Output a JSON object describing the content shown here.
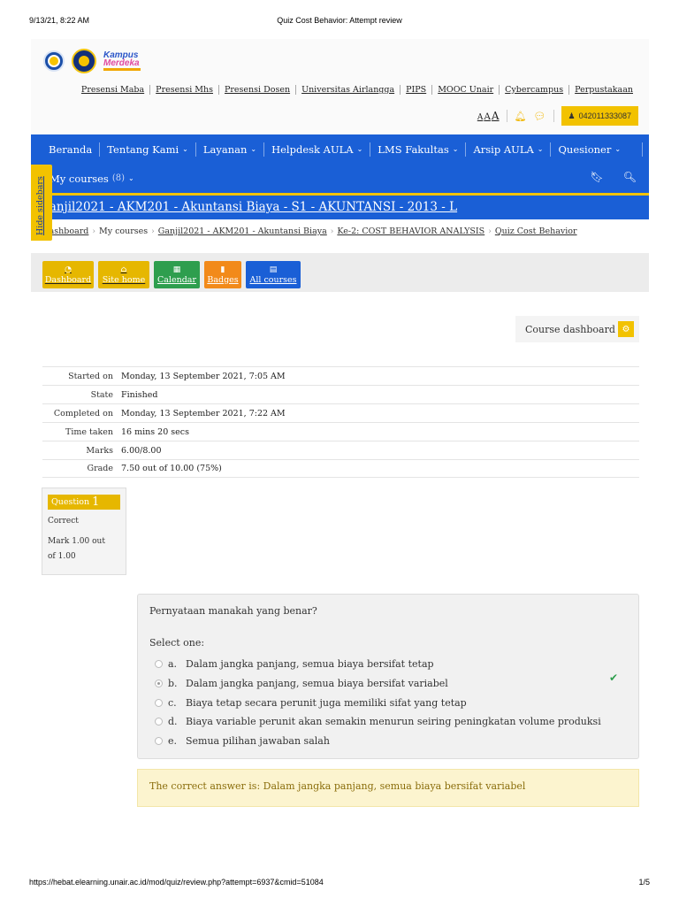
{
  "print": {
    "timestamp": "9/13/21, 8:22 AM",
    "title": "Quiz Cost Behavior: Attempt review",
    "url": "https://hebat.elearning.unair.ac.id/mod/quiz/review.php?attempt=6937&cmid=51084",
    "page": "1/5"
  },
  "logo": {
    "kampus_line1": "Kampus",
    "kampus_line2": "Merdeka"
  },
  "quicklinks": [
    "Presensi Maba",
    "Presensi Mhs",
    "Presensi Dosen",
    "Universitas Airlangga",
    "PIPS",
    "MOOC Unair",
    "Cybercampus",
    "Perpustakaan"
  ],
  "util": {
    "font_sizes": [
      "A",
      "A",
      "A"
    ],
    "phone": "0420113330​87"
  },
  "nav": {
    "items": [
      {
        "label": "Beranda",
        "dropdown": false
      },
      {
        "label": "Tentang Kami",
        "dropdown": true
      },
      {
        "label": "Layanan",
        "dropdown": true
      },
      {
        "label": "Helpdesk AULA",
        "dropdown": true
      },
      {
        "label": "LMS Fakultas",
        "dropdown": true
      },
      {
        "label": "Arsip AULA",
        "dropdown": true
      },
      {
        "label": "Quesioner",
        "dropdown": true
      }
    ],
    "mycourses_label": "My courses",
    "mycourses_count": "(8)"
  },
  "sidebar_toggle": "Hide sidebars",
  "course_title": "Ganjil2021 - AKM201 - Akuntansi Biaya - S1 - AKUNTANSI - 2013 - L",
  "breadcrumbs": [
    "Dashboard",
    "My courses",
    "Ganjil2021 - AKM201 - Akuntansi Biaya",
    "Ke-2: COST BEHAVIOR ANALYSIS",
    "Quiz Cost Behavior"
  ],
  "quickbar": [
    {
      "label": "Dashboard",
      "icon": "dashboard-icon",
      "color": "#e6b700"
    },
    {
      "label": "Site home",
      "icon": "home-icon",
      "color": "#e6b700"
    },
    {
      "label": "Calendar",
      "icon": "calendar-icon",
      "color": "#2e9e4e"
    },
    {
      "label": "Badges",
      "icon": "bookmark-icon",
      "color": "#f28a1a"
    },
    {
      "label": "All courses",
      "icon": "book-icon",
      "color": "#1a5fd6"
    }
  ],
  "course_dashboard_label": "Course dashboard",
  "summary": [
    {
      "label": "Started on",
      "value": "Monday, 13 September 2021, 7:05 AM"
    },
    {
      "label": "State",
      "value": "Finished"
    },
    {
      "label": "Completed on",
      "value": "Monday, 13 September 2021, 7:22 AM"
    },
    {
      "label": "Time taken",
      "value": "16 mins 20 secs"
    },
    {
      "label": "Marks",
      "value": "6.00/8.00"
    },
    {
      "label": "Grade",
      "value": "7.50 out of 10.00 (75%)"
    }
  ],
  "question": {
    "label": "Question",
    "number": "1",
    "state": "Correct",
    "mark": "Mark 1.00 out of 1.00",
    "text": "Pernyataan manakah yang benar?",
    "prompt": "Select one:",
    "answers": [
      {
        "letter": "a.",
        "text": "Dalam jangka panjang, semua biaya bersifat tetap",
        "selected": false
      },
      {
        "letter": "b.",
        "text": "Dalam jangka panjang, semua biaya bersifat variabel",
        "selected": true
      },
      {
        "letter": "c.",
        "text": "Biaya tetap secara perunit juga memiliki sifat yang tetap",
        "selected": false
      },
      {
        "letter": "d.",
        "text": "Biaya variable perunit akan semakin menurun seiring peningkatan volume produksi",
        "selected": false
      },
      {
        "letter": "e.",
        "text": "Semua pilihan jawaban salah",
        "selected": false
      }
    ],
    "correct_answer": "The correct answer is: Dalam jangka panjang, semua biaya bersifat variabel"
  },
  "colors": {
    "primary_blue": "#1a5fd6",
    "accent_yellow": "#f2c200",
    "green": "#2e9e4e",
    "orange": "#f28a1a"
  }
}
